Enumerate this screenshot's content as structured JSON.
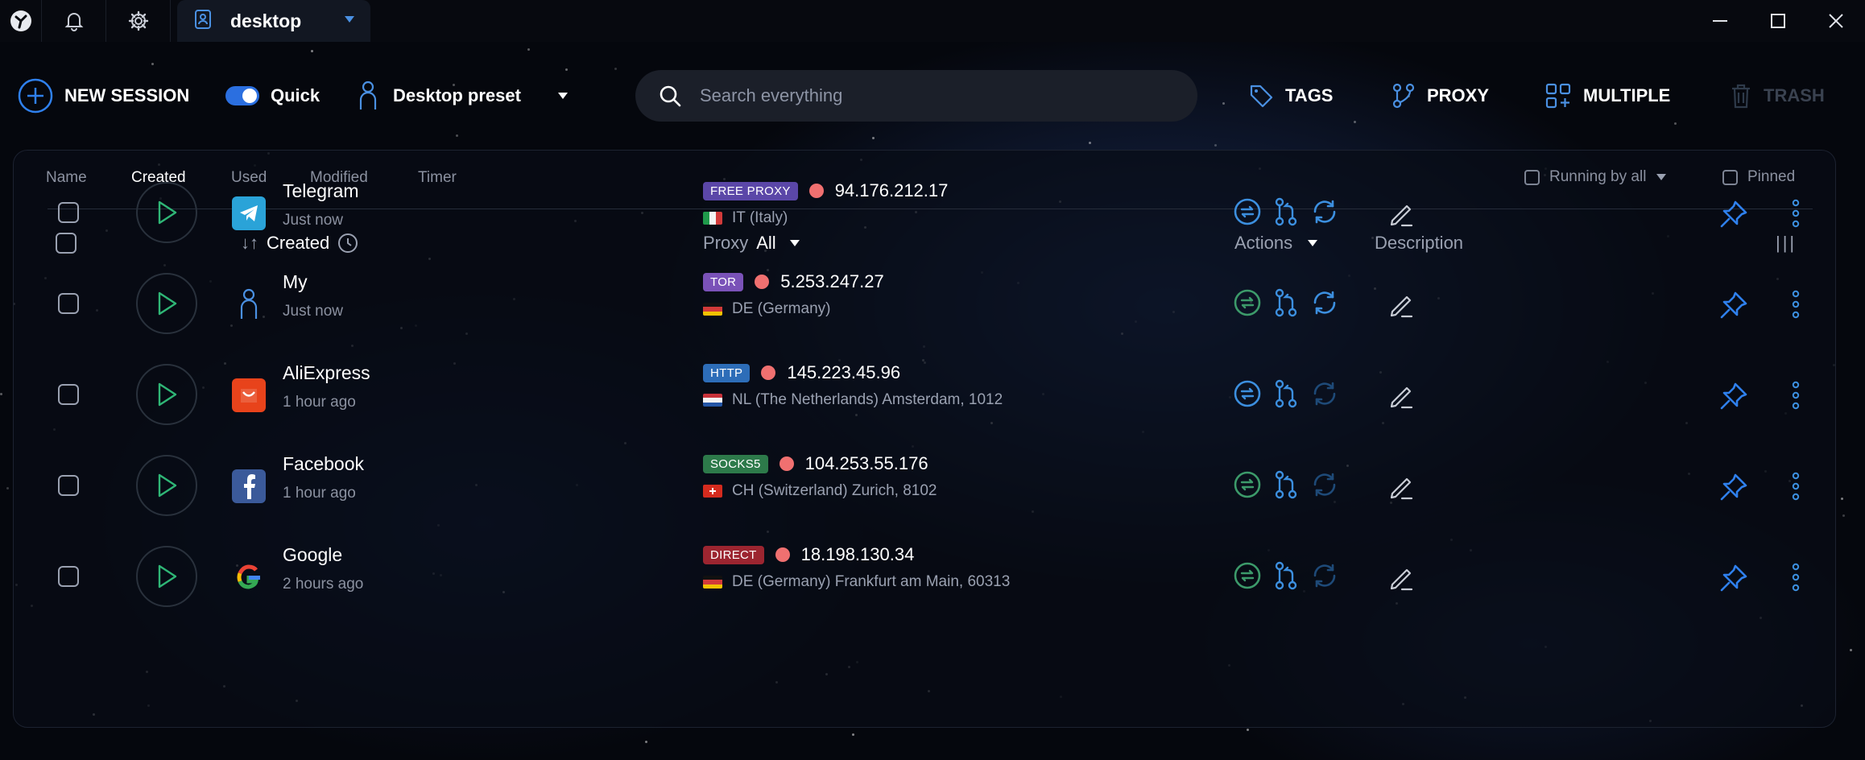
{
  "titlebar": {
    "tab_label": "desktop",
    "icons": [
      "app-logo-icon",
      "bell-icon",
      "gear-icon",
      "profile-folder-icon",
      "dropdown-arrow-icon"
    ],
    "window_controls": [
      "minimize-icon",
      "maximize-icon",
      "close-icon"
    ]
  },
  "toolbar": {
    "new_session": "NEW SESSION",
    "quick": "Quick",
    "quick_enabled": true,
    "preset": "Desktop preset",
    "search_placeholder": "Search everything",
    "tags": "TAGS",
    "proxy": "PROXY",
    "multiple": "MULTIPLE",
    "trash": "TRASH"
  },
  "sort_tabs": [
    "Name",
    "Created",
    "Used",
    "Modified",
    "Timer"
  ],
  "active_sort_tab": "Created",
  "filters": {
    "running": "Running by all",
    "pinned": "Pinned"
  },
  "table": {
    "headers": {
      "created": "Created",
      "sort_arrows": "↓↑",
      "proxy": "Proxy",
      "proxy_filter": "All",
      "actions": "Actions",
      "description": "Description",
      "columns_toggle": "|||"
    },
    "rows": [
      {
        "name": "Telegram",
        "when": "Just now",
        "icon": "telegram-icon",
        "proxy_type": "FREE PROXY",
        "badge_color": "#5b47a8",
        "ip": "94.176.212.17",
        "location": "IT (Italy)",
        "flag": "italy-flag",
        "action_color": "#3c8fdf",
        "refresh_active": true
      },
      {
        "name": "My",
        "when": "Just now",
        "icon": "person-icon",
        "proxy_type": "TOR",
        "badge_color": "#7a52b8",
        "ip": "5.253.247.27",
        "location": "DE (Germany)",
        "flag": "germany-flag",
        "action_color": "#3c9a6a",
        "refresh_active": true
      },
      {
        "name": "AliExpress",
        "when": "1 hour ago",
        "icon": "aliexpress-icon",
        "proxy_type": "HTTP",
        "badge_color": "#2d6db8",
        "ip": "145.223.45.96",
        "location": "NL (The Netherlands) Amsterdam, 1012",
        "flag": "netherlands-flag",
        "action_color": "#3c8fdf",
        "refresh_active": false
      },
      {
        "name": "Facebook",
        "when": "1 hour ago",
        "icon": "facebook-icon",
        "proxy_type": "SOCKS5",
        "badge_color": "#2d7a4a",
        "ip": "104.253.55.176",
        "location": "CH (Switzerland) Zurich, 8102",
        "flag": "switzerland-flag",
        "action_color": "#3c9a6a",
        "refresh_active": false
      },
      {
        "name": "Google",
        "when": "2 hours ago",
        "icon": "google-icon",
        "proxy_type": "DIRECT",
        "badge_color": "#9c2530",
        "ip": "18.198.130.34",
        "location": "DE (Germany) Frankfurt am Main, 60313",
        "flag": "germany-flag",
        "action_color": "#3c9a6a",
        "refresh_active": false
      }
    ]
  },
  "colors": {
    "accent": "#2f80ed",
    "background": "#05070d",
    "status_dot": "#f07070"
  }
}
